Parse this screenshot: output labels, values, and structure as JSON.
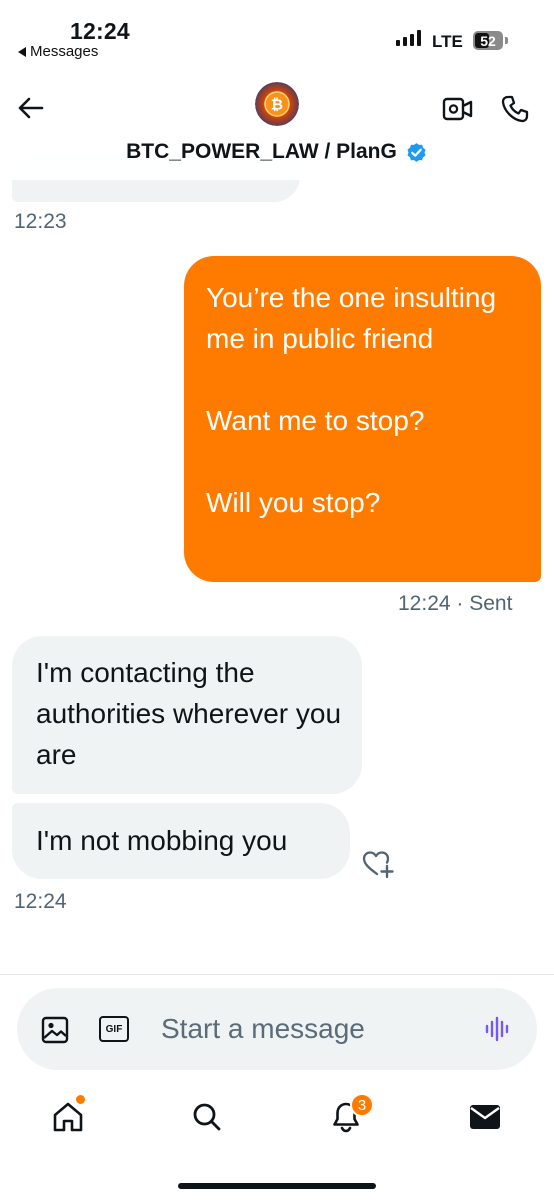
{
  "status_bar": {
    "time": "12:24",
    "back_label": "Messages",
    "network": "LTE",
    "battery_level": "52"
  },
  "header": {
    "contact_name": "BTC_POWER_LAW / PlanG",
    "verified": true,
    "avatar_icon": "bitcoin-avatar"
  },
  "messages": [
    {
      "direction": "incoming",
      "partial": true
    },
    {
      "timestamp": "12:23"
    },
    {
      "direction": "outgoing",
      "text": "You’re the one insulting me in public friend\n\nWant me to stop?\n\nWill you stop?"
    },
    {
      "timestamp": "12:24",
      "status": "· Sent"
    },
    {
      "direction": "incoming",
      "text": "I'm contacting the authorities wherever you are"
    },
    {
      "direction": "incoming",
      "text": "I'm not mobbing you"
    },
    {
      "timestamp": "12:24"
    }
  ],
  "composer": {
    "placeholder": "Start a message",
    "gif_label": "GIF"
  },
  "tabs": [
    {
      "name": "home",
      "icon": "home-icon",
      "has_dot": true
    },
    {
      "name": "search",
      "icon": "search-icon"
    },
    {
      "name": "notifications",
      "icon": "bell-icon",
      "badge": "3"
    },
    {
      "name": "messages",
      "icon": "envelope-icon",
      "active": true
    }
  ],
  "colors": {
    "accent": "#ff7b00",
    "incoming_bubble": "#eff3f4",
    "verified": "#1d9bf0",
    "voice_icon": "#7856ff",
    "secondary_text": "#536471"
  }
}
